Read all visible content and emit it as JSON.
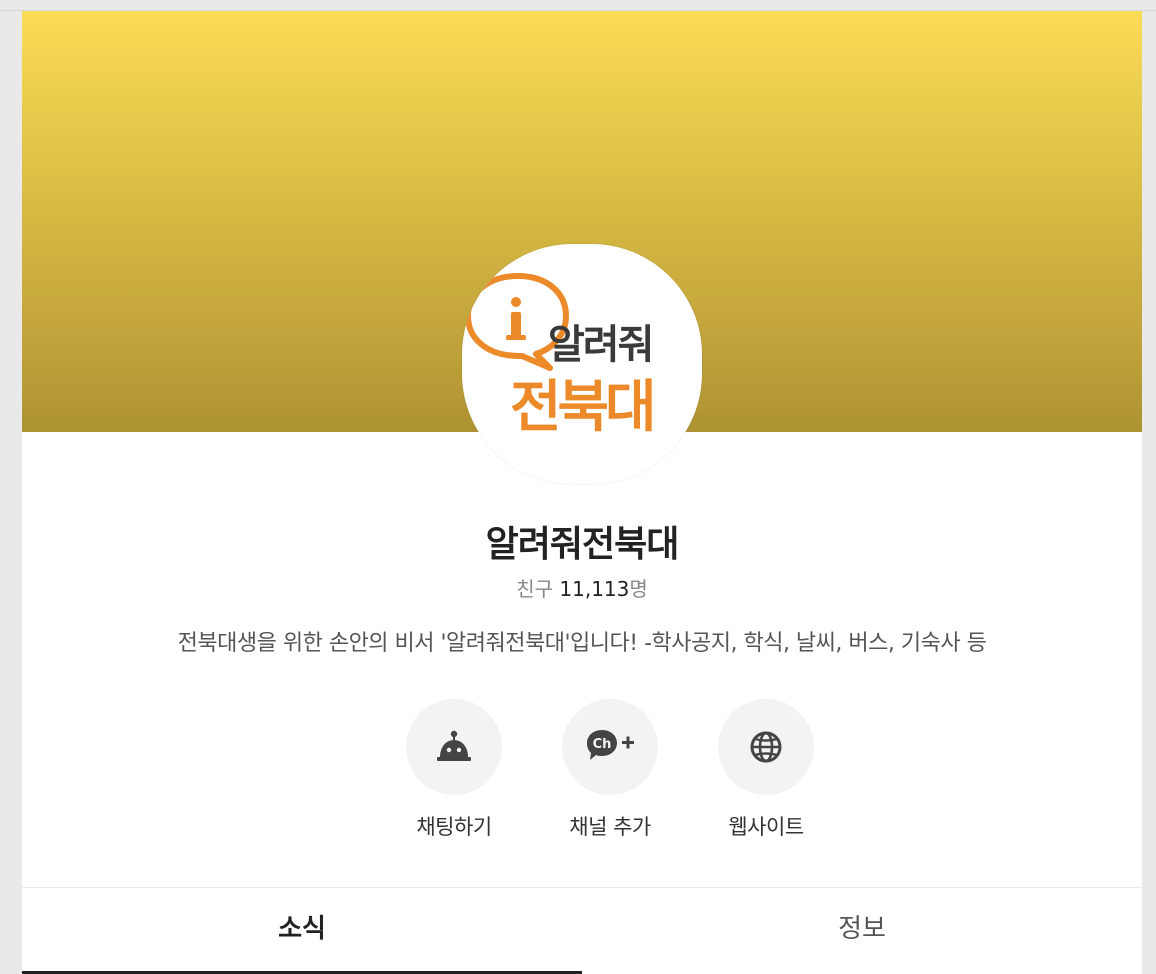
{
  "profile": {
    "logo": {
      "line1": "알려줘",
      "line2": "전북대",
      "badge_letter": "i",
      "accent_color": "#ec8a2a"
    },
    "name": "알려줘전북대",
    "friends_prefix": "친구",
    "friends_count": "11,113",
    "friends_suffix": "명",
    "description": "전북대생을 위한 손안의 비서 '알려줘전북대'입니다! -학사공지, 학식, 날씨, 버스, 기숙사 등"
  },
  "actions": [
    {
      "label": "채팅하기",
      "icon": "chatbot-icon"
    },
    {
      "label": "채널 추가",
      "icon": "channel-add-icon",
      "icon_text": "Ch"
    },
    {
      "label": "웹사이트",
      "icon": "globe-icon"
    }
  ],
  "tabs": [
    {
      "label": "소식",
      "active": true
    },
    {
      "label": "정보",
      "active": false
    }
  ],
  "colors": {
    "banner_top": "#fbdc57",
    "banner_bottom": "#ad9331",
    "text_primary": "#222222",
    "icon_color": "#444444"
  }
}
